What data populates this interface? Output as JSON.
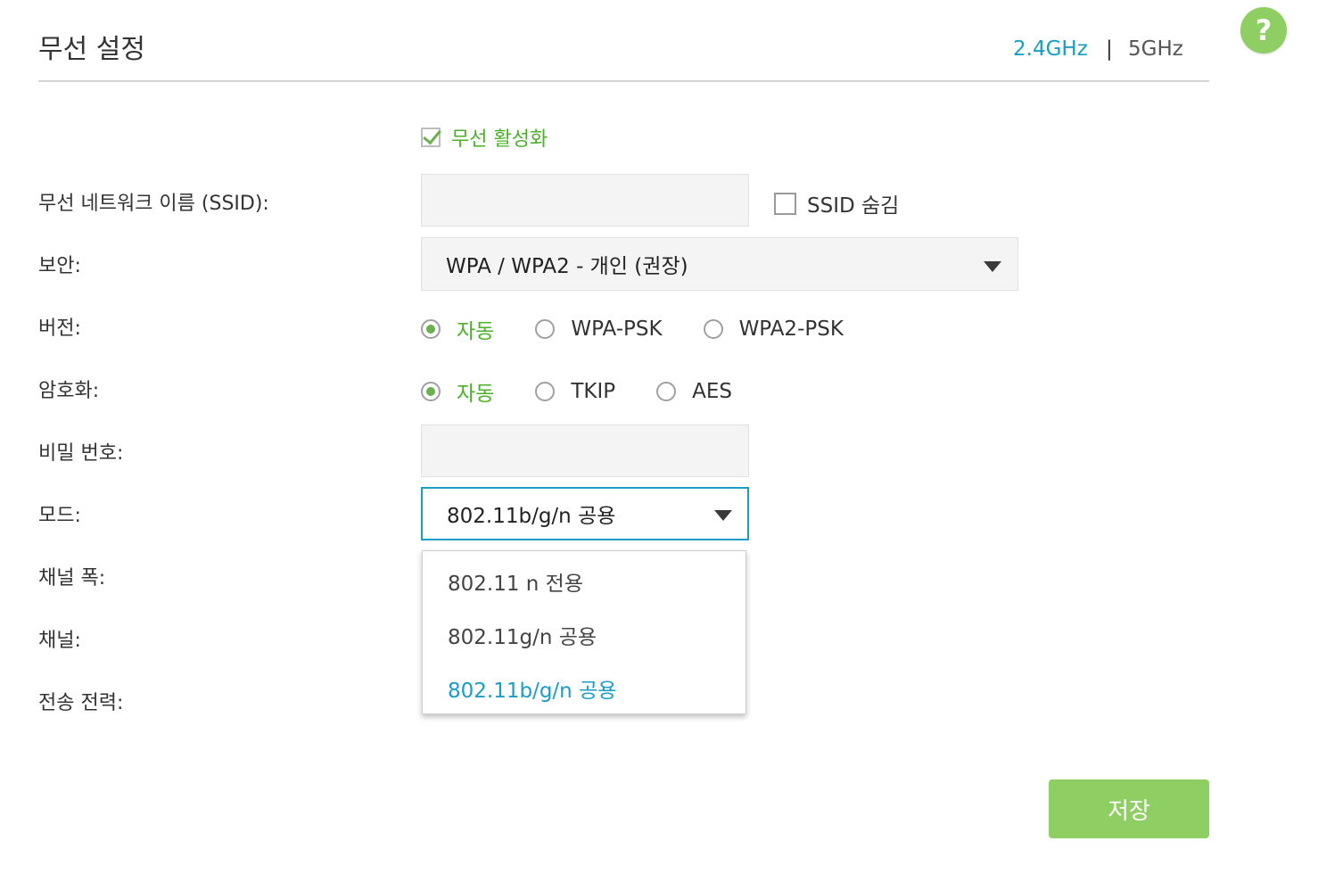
{
  "header": {
    "title": "무선 설정",
    "bands": [
      "2.4GHz",
      "|",
      "5GHz"
    ],
    "help_icon": "?"
  },
  "enable": {
    "label": "무선 활성화",
    "checked": true
  },
  "labels": {
    "ssid": "무선 네트워크 이름 (SSID):",
    "security": "보안:",
    "version": "버전:",
    "encryption": "암호화:",
    "password": "비밀 번호:",
    "mode": "모드:",
    "channel_width": "채널 폭:",
    "channel": "채널:",
    "tx_power": "전송 전력:"
  },
  "ssid": {
    "value": "",
    "hide_label": "SSID 숨김",
    "hide_checked": false
  },
  "security": {
    "value": "WPA / WPA2 - 개인 (권장)"
  },
  "version": {
    "options": [
      "자동",
      "WPA-PSK",
      "WPA2-PSK"
    ],
    "selected": "자동"
  },
  "encryption": {
    "options": [
      "자동",
      "TKIP",
      "AES"
    ],
    "selected": "자동"
  },
  "password": {
    "value": ""
  },
  "mode": {
    "value": "802.11b/g/n 공용",
    "options": [
      "802.11 n 전용",
      "802.11g/n 공용",
      "802.11b/g/n 공용"
    ],
    "selected": "802.11b/g/n 공용"
  },
  "save_label": "저장",
  "colors": {
    "accent_blue": "#1a9dc4",
    "accent_green": "#8fce62",
    "label_green": "#4caf2a"
  }
}
